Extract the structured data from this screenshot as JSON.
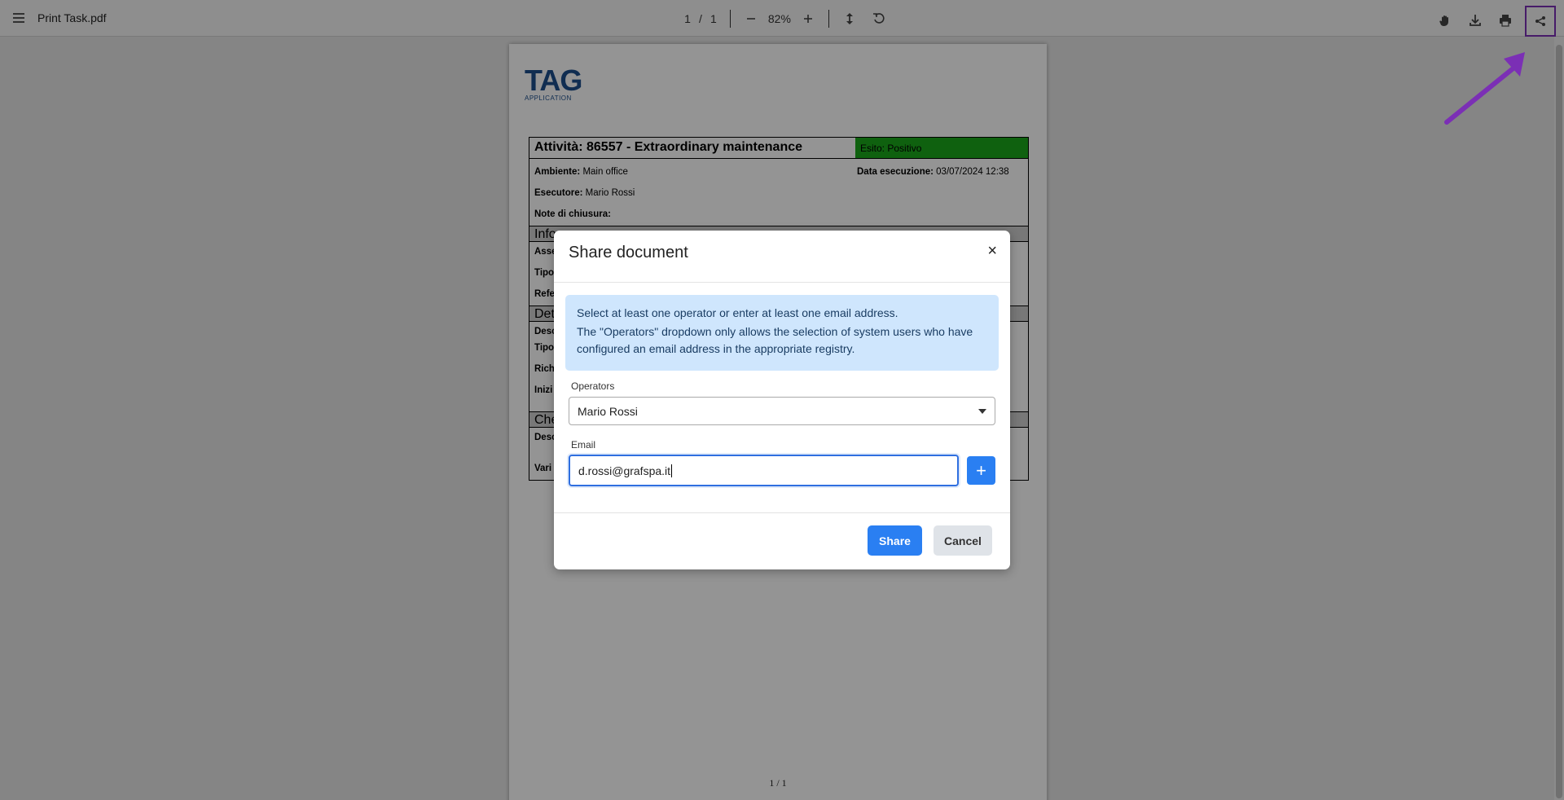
{
  "toolbar": {
    "title": "Print Task.pdf",
    "current_page": "1",
    "page_separator": "/",
    "total_pages": "1",
    "zoom": "82%",
    "icons": [
      "menu-icon",
      "zoom-out-icon",
      "zoom-in-icon",
      "fit-height-icon",
      "rotate-icon",
      "hand-tool-icon",
      "download-icon",
      "print-icon",
      "share-icon"
    ]
  },
  "document": {
    "logo_main": "TAG",
    "logo_sub": "APPLICATION",
    "title": "Attività: 86557 - Extraordinary maintenance",
    "esito_label": "Esito:",
    "esito_value": "Positivo",
    "ambiente_label": "Ambiente:",
    "ambiente_value": "Main office",
    "data_label": "Data esecuzione:",
    "data_value": "03/07/2024 12:38",
    "esecutore_label": "Esecutore:",
    "esecutore_value": "Mario Rossi",
    "note_label": "Note di chiusura:",
    "section_info": "Info",
    "frag_asse": "Asse",
    "frag_tipo": "Tipo",
    "frag_refe": "Refe",
    "section_det": "Det",
    "frag_desc": "Desc",
    "frag_tipo2": "Tipo",
    "frag_rich": "Rich",
    "frag_inizi": "Inizi",
    "section_che": "Che",
    "frag_desc2": "Desc",
    "frag_vari": "Vari",
    "footer": "1 / 1",
    "esito_color": "#1aa81a"
  },
  "modal": {
    "title": "Share document",
    "close": "×",
    "alert_line1": "Select at least one operator or enter at least one email address.",
    "alert_line2": "The \"Operators\" dropdown only allows the selection of system users who have configured an email address in the appropriate registry.",
    "operators_label": "Operators",
    "operators_value": "Mario Rossi",
    "email_label": "Email",
    "email_value": "d.rossi@grafspa.it",
    "add_label": "+",
    "share_label": "Share",
    "cancel_label": "Cancel",
    "accent_color": "#2a7ff2",
    "alert_bg": "#cfe6fd"
  },
  "annotation": {
    "highlight_color": "#7b2fb5",
    "arrow_color": "#7b2fb5"
  }
}
